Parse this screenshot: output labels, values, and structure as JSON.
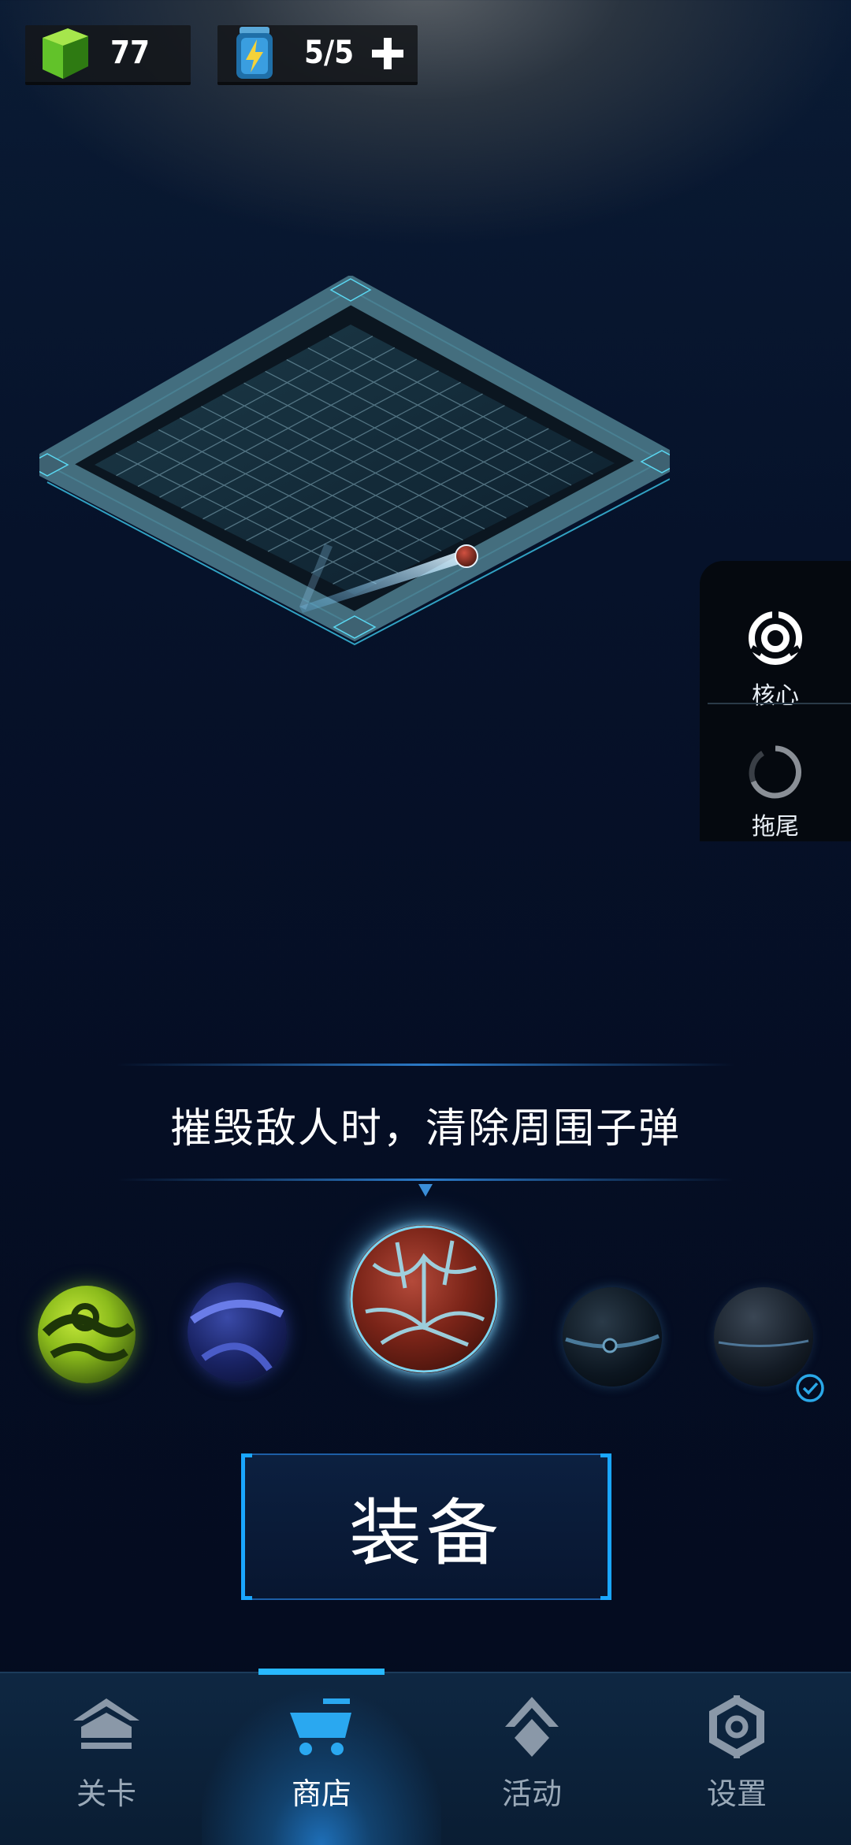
{
  "resources": {
    "gems": {
      "value": "77",
      "icon": "green-gem-icon"
    },
    "energy": {
      "value": "5/5",
      "icon": "energy-battery-icon",
      "add_icon": "plus-icon"
    }
  },
  "side_panel": {
    "items": [
      {
        "label": "核心",
        "icon": "core-ring-icon",
        "active": true
      },
      {
        "label": "拖尾",
        "icon": "trail-arc-icon",
        "active": false
      }
    ]
  },
  "description": "摧毁敌人时，清除周围子弹",
  "balls": [
    {
      "name": "green-striped-ball",
      "selected": false,
      "equipped": false
    },
    {
      "name": "blue-banded-ball",
      "selected": false,
      "equipped": false
    },
    {
      "name": "red-cracked-ball",
      "selected": true,
      "equipped": false
    },
    {
      "name": "dark-ringed-ball",
      "selected": false,
      "equipped": false
    },
    {
      "name": "dark-plain-ball",
      "selected": false,
      "equipped": true
    }
  ],
  "equip_button": "装备",
  "nav": {
    "active": 1,
    "tabs": [
      {
        "label": "关卡",
        "icon": "levels-icon"
      },
      {
        "label": "商店",
        "icon": "shop-cart-icon"
      },
      {
        "label": "活动",
        "icon": "events-icon"
      },
      {
        "label": "设置",
        "icon": "settings-gear-icon"
      }
    ]
  },
  "colors": {
    "accent": "#1aa6ff",
    "background": "#050e24",
    "nav_bg": "#0e2742"
  }
}
